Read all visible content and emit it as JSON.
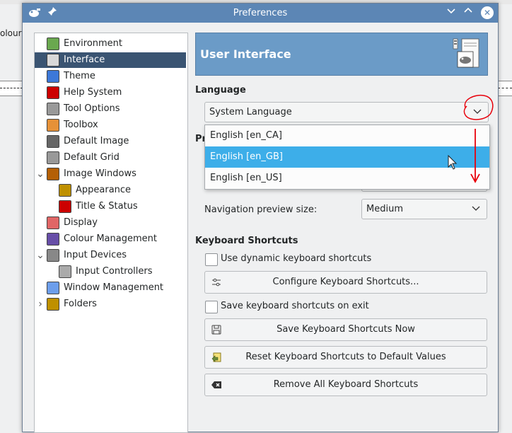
{
  "background": {
    "partial_label": "olours"
  },
  "dialog": {
    "title": "Preferences",
    "titlebar_icons": [
      "gimp-icon",
      "pin-icon",
      "chevron-down-icon",
      "chevron-up-icon",
      "close-icon"
    ]
  },
  "sidebar": {
    "items": [
      {
        "label": "Environment",
        "icon": "environment-icon",
        "indent": 0,
        "selected": false
      },
      {
        "label": "Interface",
        "icon": "interface-icon",
        "indent": 0,
        "selected": true
      },
      {
        "label": "Theme",
        "icon": "theme-icon",
        "indent": 0,
        "selected": false
      },
      {
        "label": "Help System",
        "icon": "help-system-icon",
        "indent": 0,
        "selected": false
      },
      {
        "label": "Tool Options",
        "icon": "tool-options-icon",
        "indent": 0,
        "selected": false
      },
      {
        "label": "Toolbox",
        "icon": "toolbox-icon",
        "indent": 0,
        "selected": false
      },
      {
        "label": "Default Image",
        "icon": "default-image-icon",
        "indent": 0,
        "selected": false
      },
      {
        "label": "Default Grid",
        "icon": "default-grid-icon",
        "indent": 0,
        "selected": false
      },
      {
        "label": "Image Windows",
        "icon": "image-windows-icon",
        "indent": 0,
        "selected": false,
        "expander": "expanded"
      },
      {
        "label": "Appearance",
        "icon": "appearance-icon",
        "indent": 1,
        "selected": false
      },
      {
        "label": "Title & Status",
        "icon": "title-status-icon",
        "indent": 1,
        "selected": false
      },
      {
        "label": "Display",
        "icon": "display-icon",
        "indent": 0,
        "selected": false
      },
      {
        "label": "Colour Management",
        "icon": "colour-management-icon",
        "indent": 0,
        "selected": false
      },
      {
        "label": "Input Devices",
        "icon": "input-devices-icon",
        "indent": 0,
        "selected": false,
        "expander": "expanded"
      },
      {
        "label": "Input Controllers",
        "icon": "input-controllers-icon",
        "indent": 1,
        "selected": false
      },
      {
        "label": "Window Management",
        "icon": "window-management-icon",
        "indent": 0,
        "selected": false
      },
      {
        "label": "Folders",
        "icon": "folders-icon",
        "indent": 0,
        "selected": false,
        "expander": "collapsed"
      }
    ]
  },
  "main": {
    "banner_title": "User Interface",
    "language": {
      "heading": "Language",
      "selected": "System Language",
      "options": [
        "English [en_CA]",
        "English [en_GB]",
        "English [en_US]"
      ],
      "highlighted_option": "English [en_GB]"
    },
    "hidden_heading_fragment": "Pr",
    "navigation": {
      "label": "Navigation preview size:",
      "value": "Medium"
    },
    "keyboard_shortcuts": {
      "heading": "Keyboard Shortcuts",
      "dynamic_checkbox_label": "Use dynamic keyboard shortcuts",
      "dynamic_checked": false,
      "configure_button": "Configure Keyboard Shortcuts...",
      "save_on_exit_label": "Save keyboard shortcuts on exit",
      "save_on_exit_checked": false,
      "save_now_button": "Save Keyboard Shortcuts Now",
      "reset_button": "Reset Keyboard Shortcuts to Default Values",
      "remove_button": "Remove All Keyboard Shortcuts"
    }
  },
  "colors": {
    "titlebar": "#5c86b5",
    "selection": "#3a5472",
    "popup_highlight": "#3daee9",
    "banner": "#6b9bc7",
    "annotation": "#e8000b"
  }
}
